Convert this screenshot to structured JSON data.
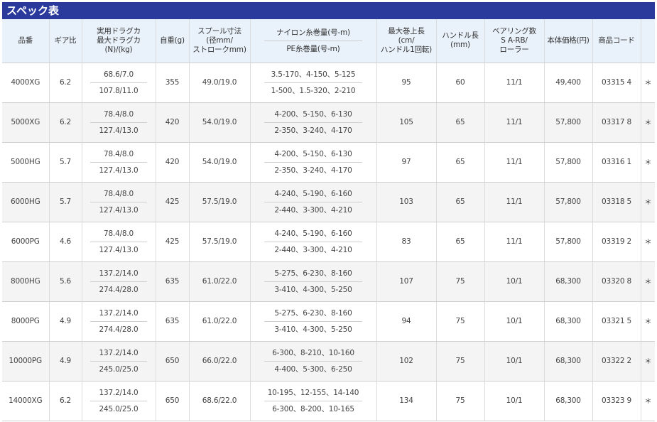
{
  "title": "スペック表",
  "headers": {
    "model": "品番",
    "gear": "ギア比",
    "drag_top": "実用ドラグカ",
    "drag_bot1": "最大ドラグカ",
    "drag_bot2": "(N)/(kg)",
    "weight": "自重(g)",
    "spool_1": "スプール寸法",
    "spool_2": "(径mm/",
    "spool_3": "ストロークmm)",
    "line_top": "ナイロン糸巻量(号-m)",
    "line_bot": "PE糸巻量(号-m)",
    "retrieve_1": "最大巻上長",
    "retrieve_2": "(cm/",
    "retrieve_3": "ハンドル1回転)",
    "handle_1": "ハンドル長",
    "handle_2": "(mm)",
    "bearing_1": "ベアリング数",
    "bearing_2": "S A-RB/",
    "bearing_3": "ローラー",
    "price": "本体価格(円)",
    "code": "商品コード",
    "extra": ""
  },
  "rows": [
    {
      "model": "4000XG",
      "gear": "6.2",
      "drag_top": "68.6/7.0",
      "drag_bot": "107.8/11.0",
      "weight": "355",
      "spool": "49.0/19.0",
      "line_top": "3.5-170、4-150、5-125",
      "line_bot": "1-500、1.5-320、2-210",
      "retrieve": "95",
      "handle": "60",
      "bearing": "11/1",
      "price": "49,400",
      "code": "03315 4",
      "mark": "＊"
    },
    {
      "model": "5000XG",
      "gear": "6.2",
      "drag_top": "78.4/8.0",
      "drag_bot": "127.4/13.0",
      "weight": "420",
      "spool": "54.0/19.0",
      "line_top": "4-200、5-150、6-130",
      "line_bot": "2-350、3-240、4-170",
      "retrieve": "105",
      "handle": "65",
      "bearing": "11/1",
      "price": "57,800",
      "code": "03317 8",
      "mark": "＊"
    },
    {
      "model": "5000HG",
      "gear": "5.7",
      "drag_top": "78.4/8.0",
      "drag_bot": "127.4/13.0",
      "weight": "420",
      "spool": "54.0/19.0",
      "line_top": "4-200、5-150、6-130",
      "line_bot": "2-350、3-240、4-170",
      "retrieve": "97",
      "handle": "65",
      "bearing": "11/1",
      "price": "57,800",
      "code": "03316 1",
      "mark": "＊"
    },
    {
      "model": "6000HG",
      "gear": "5.7",
      "drag_top": "78.4/8.0",
      "drag_bot": "127.4/13.0",
      "weight": "425",
      "spool": "57.5/19.0",
      "line_top": "4-240、5-190、6-160",
      "line_bot": "2-440、3-300、4-210",
      "retrieve": "103",
      "handle": "65",
      "bearing": "11/1",
      "price": "57,800",
      "code": "03318 5",
      "mark": "＊"
    },
    {
      "model": "6000PG",
      "gear": "4.6",
      "drag_top": "78.4/8.0",
      "drag_bot": "127.4/13.0",
      "weight": "425",
      "spool": "57.5/19.0",
      "line_top": "4-240、5-190、6-160",
      "line_bot": "2-440、3-300、4-210",
      "retrieve": "83",
      "handle": "65",
      "bearing": "11/1",
      "price": "57,800",
      "code": "03319 2",
      "mark": "＊"
    },
    {
      "model": "8000HG",
      "gear": "5.6",
      "drag_top": "137.2/14.0",
      "drag_bot": "274.4/28.0",
      "weight": "635",
      "spool": "61.0/22.0",
      "line_top": "5-275、6-230、8-160",
      "line_bot": "3-410、4-300、5-250",
      "retrieve": "107",
      "handle": "75",
      "bearing": "10/1",
      "price": "68,300",
      "code": "03320 8",
      "mark": "＊"
    },
    {
      "model": "8000PG",
      "gear": "4.9",
      "drag_top": "137.2/14.0",
      "drag_bot": "274.4/28.0",
      "weight": "635",
      "spool": "61.0/22.0",
      "line_top": "5-275、6-230、8-160",
      "line_bot": "3-410、4-300、5-250",
      "retrieve": "94",
      "handle": "75",
      "bearing": "10/1",
      "price": "68,300",
      "code": "03321 5",
      "mark": "＊"
    },
    {
      "model": "10000PG",
      "gear": "4.9",
      "drag_top": "137.2/14.0",
      "drag_bot": "245.0/25.0",
      "weight": "650",
      "spool": "66.0/22.0",
      "line_top": "6-300、8-210、10-160",
      "line_bot": "4-400、5-300、6-250",
      "retrieve": "102",
      "handle": "75",
      "bearing": "10/1",
      "price": "68,300",
      "code": "03322 2",
      "mark": "＊"
    },
    {
      "model": "14000XG",
      "gear": "6.2",
      "drag_top": "137.2/14.0",
      "drag_bot": "245.0/25.0",
      "weight": "650",
      "spool": "68.6/22.0",
      "line_top": "10-195、12-155、14-140",
      "line_bot": "6-300、8-200、10-165",
      "retrieve": "134",
      "handle": "75",
      "bearing": "10/1",
      "price": "68,300",
      "code": "03323 9",
      "mark": "＊"
    }
  ]
}
